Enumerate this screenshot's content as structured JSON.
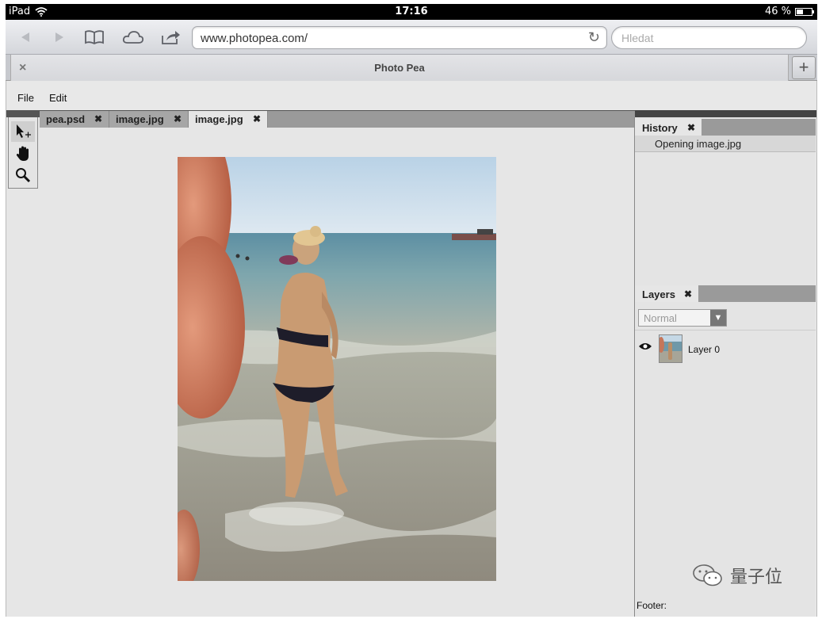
{
  "status_bar": {
    "device": "iPad",
    "time": "17:16",
    "battery": "46 %",
    "battery_level": 0.46
  },
  "browser": {
    "url": "www.photopea.com/",
    "search_placeholder": "Hledat",
    "tab_title": "Photo Pea",
    "tab_close": "×",
    "new_tab": "+"
  },
  "app": {
    "menu": [
      "File",
      "Edit"
    ],
    "doc_tabs": [
      {
        "label": "pea.psd",
        "close": "✖",
        "active": false
      },
      {
        "label": "image.jpg",
        "close": "✖",
        "active": false
      },
      {
        "label": "image.jpg",
        "close": "✖",
        "active": true
      }
    ],
    "tools": [
      "move-tool",
      "hand-tool",
      "zoom-tool"
    ],
    "history": {
      "title": "History",
      "close": "✖",
      "items": [
        "Opening image.jpg"
      ]
    },
    "layers": {
      "title": "Layers",
      "close": "✖",
      "blend_mode": "Normal",
      "items": [
        {
          "name": "Layer 0",
          "visible": true
        }
      ]
    },
    "footer_label": "Footer:"
  },
  "watermark": {
    "text": "量子位"
  },
  "colors": {
    "panel_gray": "#e4e4e4",
    "tab_gray": "#9a9a9a",
    "status_black": "#000000"
  }
}
